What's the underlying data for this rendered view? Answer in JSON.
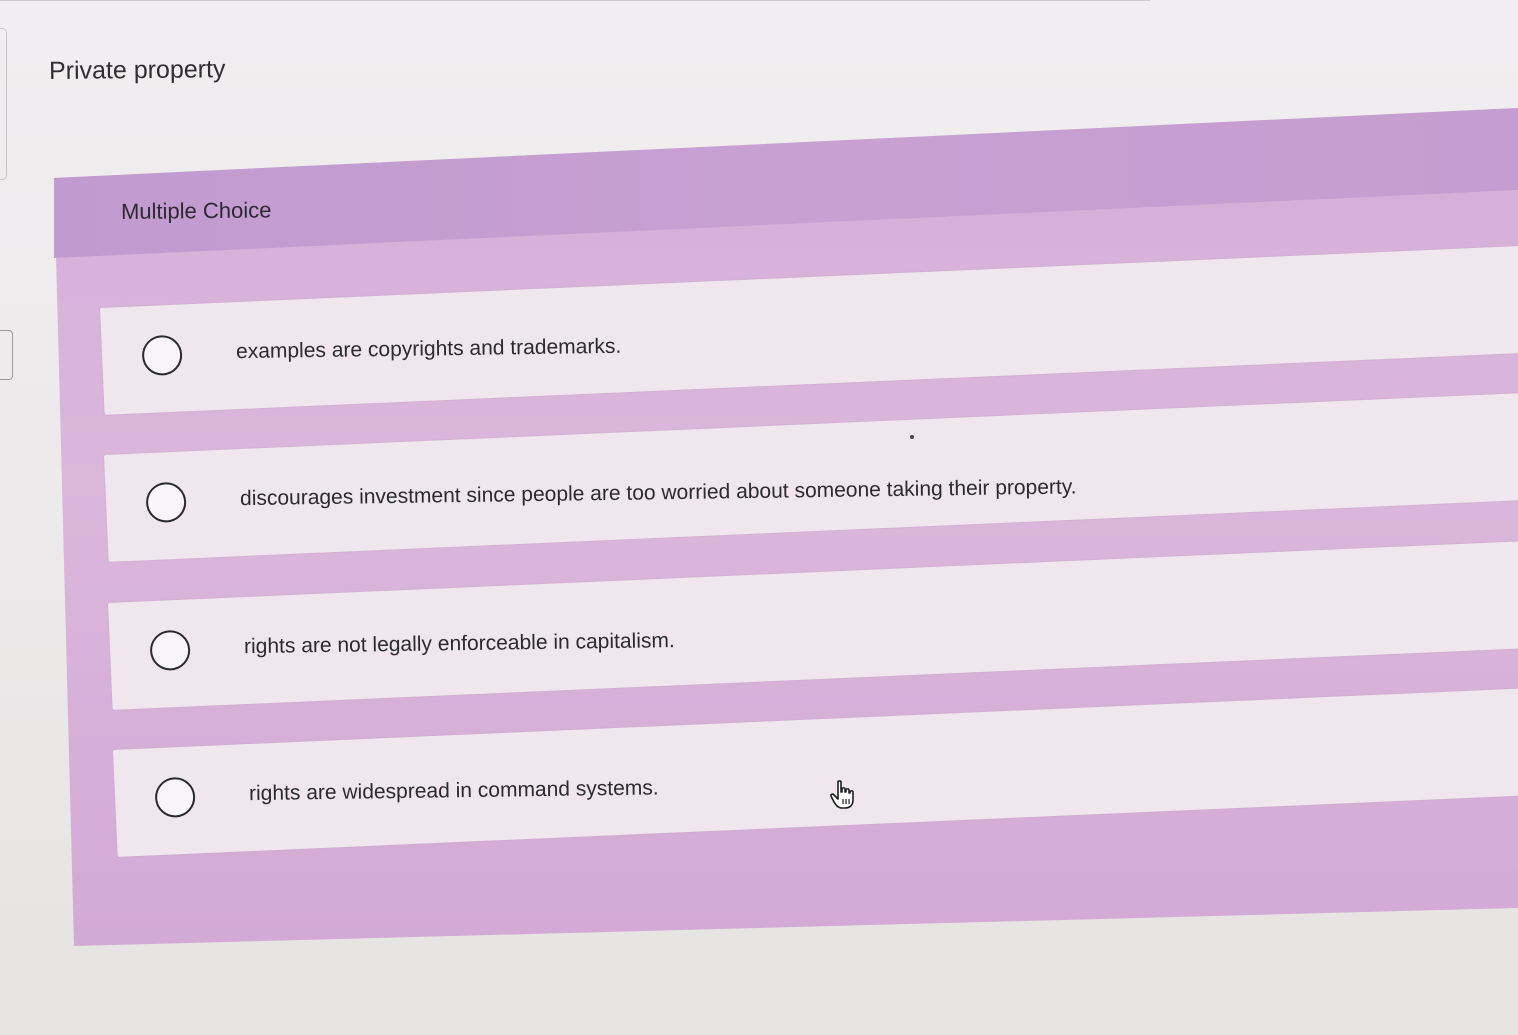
{
  "question": {
    "title": "Private property"
  },
  "panel": {
    "type_label": "Multiple Choice"
  },
  "options": [
    {
      "text": "examples are copyrights and trademarks.",
      "selected": false
    },
    {
      "text": "discourages investment since people are too worried about someone taking their property.",
      "selected": false
    },
    {
      "text": "rights are not legally enforceable in capitalism.",
      "selected": false
    },
    {
      "text": "rights are widespread in command systems.",
      "selected": false
    }
  ],
  "cursor": {
    "icon": "hand-pointer-icon"
  },
  "colors": {
    "panel": "#d8b3d9",
    "header": "#c59dd0",
    "option_bg": "#efe6ee",
    "text": "#2b2b2e"
  }
}
